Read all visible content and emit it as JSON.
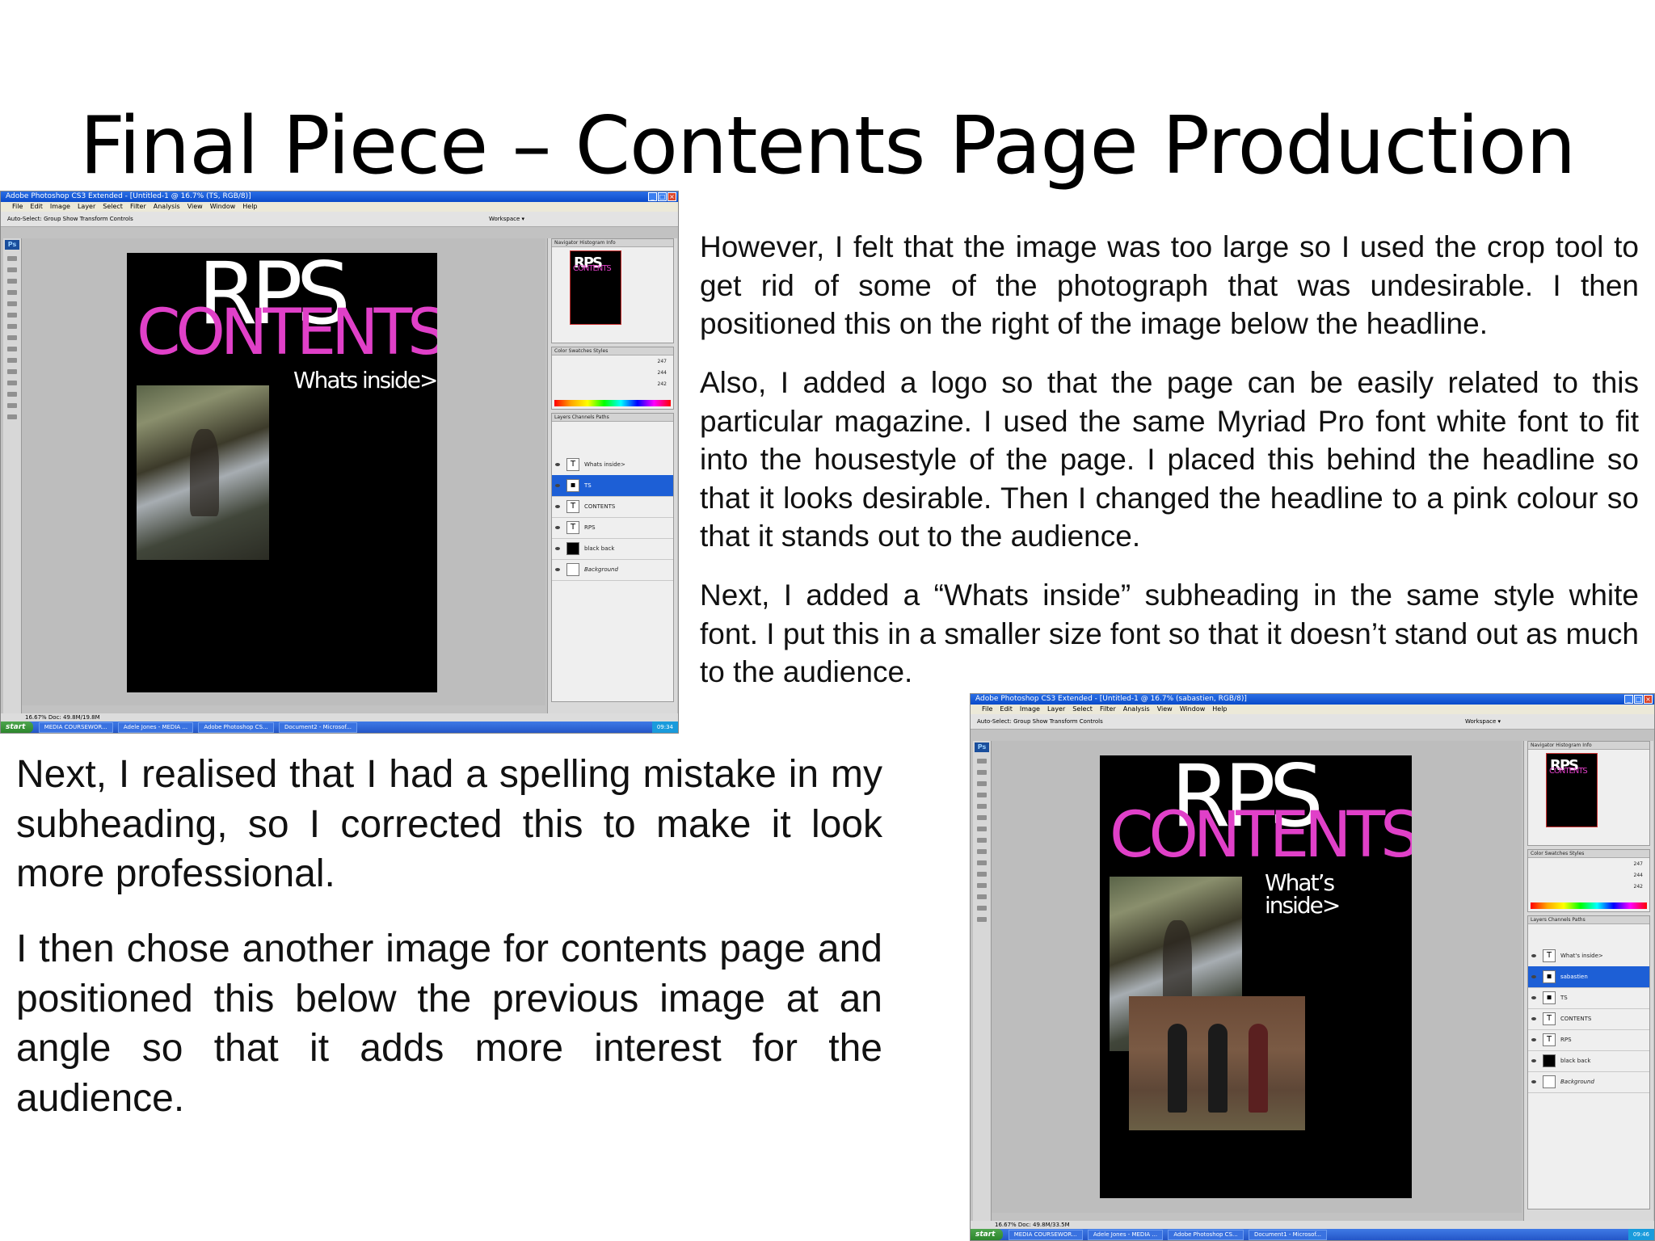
{
  "slide": {
    "title": "Final Piece – Contents Page Production",
    "right_paragraphs": [
      "However, I felt that the image was too large so I used the crop tool to get rid of some of the photograph that was undesirable. I then positioned this on the right of the image below the headline.",
      "Also, I added a logo so that the page can be easily related to this particular magazine. I used the same Myriad Pro font white font to fit into the housestyle of the page. I placed this behind the headline so that it looks desirable. Then I changed the headline to a pink colour so that it stands out to the audience.",
      "Next, I added a “Whats inside” subheading in the same style white font. I put this in a smaller size font so that it doesn’t stand out as much to the audience."
    ],
    "left_paragraphs": [
      "Next, I realised that I had a spelling mistake in my subheading, so I corrected this to make it look more professional.",
      "I then chose another image for contents page and positioned this below the previous image at an angle so that it adds more interest for the audience."
    ]
  },
  "screenshot1": {
    "window_title": "Adobe Photoshop CS3 Extended - [Untitled-1 @ 16.7% (TS, RGB/8)]",
    "menu": [
      "File",
      "Edit",
      "Image",
      "Layer",
      "Select",
      "Filter",
      "Analysis",
      "View",
      "Window",
      "Help"
    ],
    "options": "Auto-Select: Group    Show Transform Controls",
    "workspace": "Workspace ▾",
    "logo": "RPS",
    "headline": "CONTENTS",
    "subheading": "Whats inside>",
    "panel_tabs": {
      "navigator": "Navigator  Histogram  Info",
      "color": "Color  Swatches  Styles",
      "layers": "Layers  Channels  Paths"
    },
    "color_values": [
      "247",
      "244",
      "242"
    ],
    "layers": [
      "Whats inside>",
      "TS",
      "CONTENTS",
      "RPS",
      "black back",
      "Background"
    ],
    "selected_layer": 1,
    "status": "16.67%     Doc: 49.8M/19.8M",
    "taskbar": {
      "start": "start",
      "tasks": [
        "MEDIA COURSEWOR...",
        "Adele Jones - MEDIA ...",
        "Adobe Photoshop CS...",
        "Document2 - Microsof..."
      ],
      "clock": "09:34"
    }
  },
  "screenshot2": {
    "window_title": "Adobe Photoshop CS3 Extended - [Untitled-1 @ 16.7% (sabastien, RGB/8)]",
    "menu": [
      "File",
      "Edit",
      "Image",
      "Layer",
      "Select",
      "Filter",
      "Analysis",
      "View",
      "Window",
      "Help"
    ],
    "options": "Auto-Select: Group    Show Transform Controls",
    "workspace": "Workspace ▾",
    "logo": "RPS",
    "headline": "CONTENTS",
    "subheading": "What’s inside>",
    "panel_tabs": {
      "navigator": "Navigator  Histogram  Info",
      "color": "Color  Swatches  Styles",
      "layers": "Layers  Channels  Paths"
    },
    "color_values": [
      "247",
      "244",
      "242"
    ],
    "layers": [
      "What's inside>",
      "sabastien",
      "TS",
      "CONTENTS",
      "RPS",
      "black back",
      "Background"
    ],
    "selected_layer": 1,
    "status": "16.67%     Doc: 49.8M/33.5M",
    "taskbar": {
      "start": "start",
      "tasks": [
        "MEDIA COURSEWOR...",
        "Adele Jones - MEDIA ...",
        "Adobe Photoshop CS...",
        "Document1 - Microsof..."
      ],
      "clock": "09:46"
    }
  }
}
